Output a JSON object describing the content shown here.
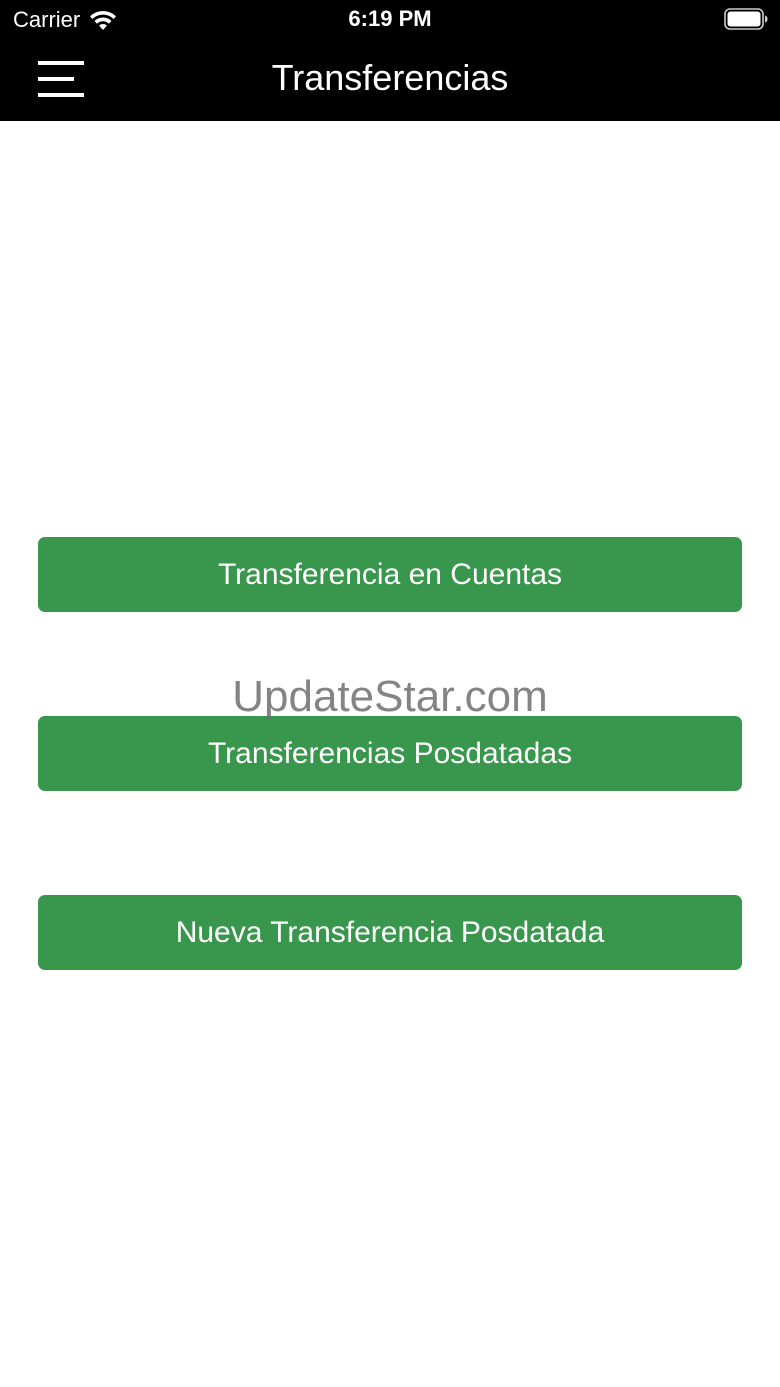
{
  "status_bar": {
    "carrier": "Carrier",
    "time": "6:19 PM"
  },
  "nav_bar": {
    "title": "Transferencias",
    "menu_icon": "hamburger-menu-icon"
  },
  "buttons": {
    "transfer_accounts": "Transferencia en Cuentas",
    "postdated_transfers": "Transferencias Posdatadas",
    "new_postdated_transfer": "Nueva Transferencia Posdatada"
  },
  "watermark": "UpdateStar.com",
  "colors": {
    "top_bar": "#000000",
    "button_green": "#38974c",
    "button_text": "#ffffff",
    "background": "#ffffff"
  }
}
